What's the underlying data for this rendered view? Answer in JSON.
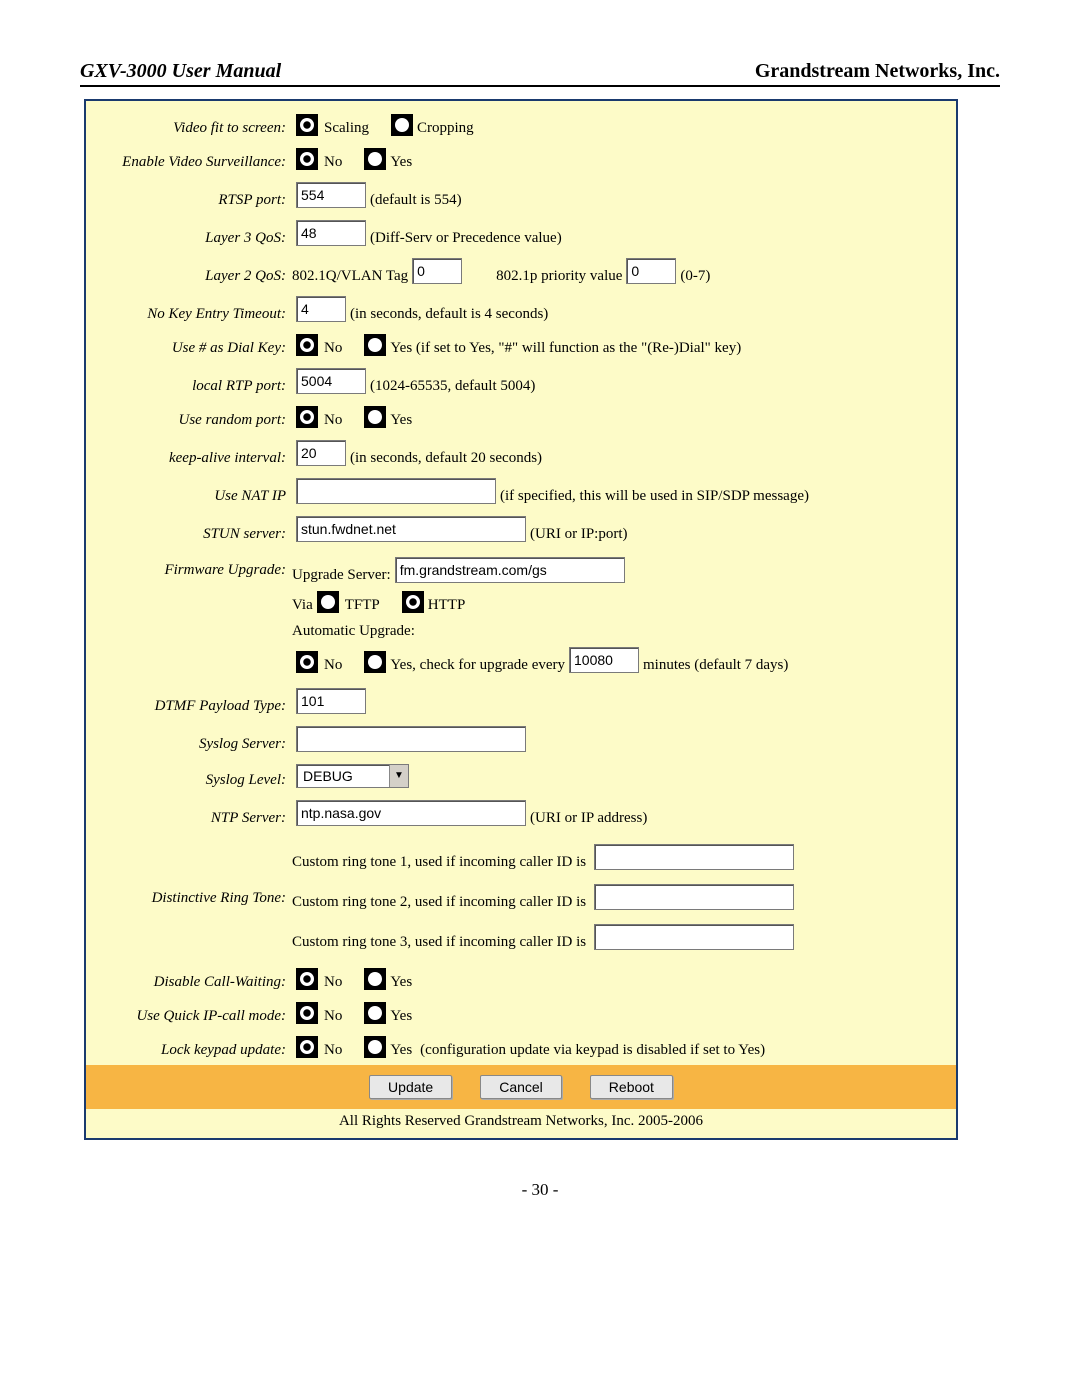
{
  "header": {
    "left": "GXV-3000 User Manual",
    "right": "Grandstream Networks, Inc."
  },
  "rows": {
    "video_fit": {
      "label": "Video fit to screen:",
      "opt1": "Scaling",
      "opt2": "Cropping"
    },
    "enable_video_surv": {
      "label": "Enable Video Surveillance:",
      "opt1": "No",
      "opt2": "Yes"
    },
    "rtsp_port": {
      "label": "RTSP port:",
      "value": "554",
      "hint": "(default is 554)"
    },
    "layer3": {
      "label": "Layer 3 QoS:",
      "value": "48",
      "hint": "(Diff-Serv or Precedence value)"
    },
    "layer2": {
      "label": "Layer 2 QoS:",
      "tag_label": "802.1Q/VLAN Tag",
      "tag_value": "0",
      "pri_label": "802.1p priority value",
      "pri_value": "0",
      "range": "(0-7)"
    },
    "nokey": {
      "label": "No Key Entry Timeout:",
      "value": "4",
      "hint": "(in seconds, default is 4 seconds)"
    },
    "hash_dial": {
      "label": "Use # as Dial Key:",
      "opt1": "No",
      "opt2": "Yes (if set to Yes, \"#\" will function as the \"(Re-)Dial\" key)"
    },
    "local_rtp": {
      "label": "local RTP port:",
      "value": "5004",
      "hint": "(1024-65535, default 5004)"
    },
    "random_port": {
      "label": "Use random port:",
      "opt1": "No",
      "opt2": "Yes"
    },
    "keepalive": {
      "label": "keep-alive interval:",
      "value": "20",
      "hint": "(in seconds, default 20 seconds)"
    },
    "nat_ip": {
      "label": "Use NAT IP",
      "value": "",
      "hint": "(if specified, this will be used in SIP/SDP message)"
    },
    "stun": {
      "label": "STUN server:",
      "value": "stun.fwdnet.net",
      "hint": "(URI or IP:port)"
    },
    "firmware": {
      "label": "Firmware Upgrade:",
      "upgrade_server_label": "Upgrade Server:",
      "upgrade_server_value": "fm.grandstream.com/gs",
      "via_label": "Via",
      "via_opt1": "TFTP",
      "via_opt2": "HTTP",
      "auto_label": "Automatic Upgrade:",
      "auto_opt1": "No",
      "auto_opt2_pre": "Yes, check for upgrade every",
      "auto_value": "10080",
      "auto_opt2_post": "minutes (default 7 days)"
    },
    "dtmf": {
      "label": "DTMF Payload Type:",
      "value": "101"
    },
    "syslog_server": {
      "label": "Syslog Server:",
      "value": ""
    },
    "syslog_level": {
      "label": "Syslog Level:",
      "value": "DEBUG"
    },
    "ntp": {
      "label": "NTP Server:",
      "value": "ntp.nasa.gov",
      "hint": "(URI or IP address)"
    },
    "ringtone": {
      "label": "Distinctive Ring Tone:",
      "line1": "Custom ring tone 1, used if incoming caller ID is",
      "line2": "Custom ring tone 2, used if incoming caller ID is",
      "line3": "Custom ring tone 3, used if incoming caller ID is"
    },
    "disable_cw": {
      "label": "Disable Call-Waiting:",
      "opt1": "No",
      "opt2": "Yes"
    },
    "quick_ip": {
      "label": "Use Quick IP-call mode:",
      "opt1": "No",
      "opt2": "Yes"
    },
    "lock_keypad": {
      "label": "Lock keypad update:",
      "opt1": "No",
      "opt2": "Yes",
      "hint": "(configuration update via keypad is disabled if set to Yes)"
    }
  },
  "buttons": {
    "update": "Update",
    "cancel": "Cancel",
    "reboot": "Reboot"
  },
  "copyright": "All Rights Reserved Grandstream Networks, Inc. 2005-2006",
  "page_number": "- 30 -"
}
